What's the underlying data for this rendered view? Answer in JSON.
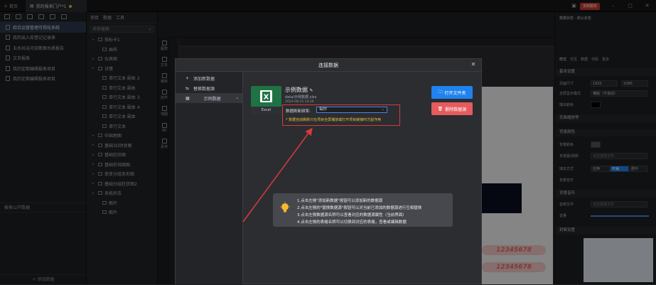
{
  "titlebar": {
    "home_tab": "首页",
    "project_tab": "我的报表门户*1",
    "brand_button": "定制服务"
  },
  "left_panel": {
    "projects": [
      "综合运营管理可视化系统",
      "我的出入库登记记录表",
      "五水共治河流断面水质报告",
      "文旦报表",
      "我的定期编辑报表项目",
      "我的定期编辑报表项目"
    ],
    "section_label": "报表公开数据",
    "add_data_label": "+ 添加数据"
  },
  "layer_panel": {
    "tabs": [
      "项目",
      "数据",
      "工具"
    ],
    "search_placeholder": "名称搜索",
    "items": [
      {
        "label": "指标卡1",
        "indent": 1
      },
      {
        "label": "画布",
        "indent": 2
      },
      {
        "label": "仪表图",
        "indent": 1
      },
      {
        "label": "详情",
        "indent": 1
      },
      {
        "label": "单行文本 副本 2",
        "indent": 2
      },
      {
        "label": "单行文本 副本",
        "indent": 2
      },
      {
        "label": "单行文本 副本 3",
        "indent": 2
      },
      {
        "label": "单行文本 副本 4",
        "indent": 2
      },
      {
        "label": "单行文本 副本",
        "indent": 2
      },
      {
        "label": "单行文本",
        "indent": 2
      },
      {
        "label": "中国地图",
        "indent": 1
      },
      {
        "label": "基础3D饼状图",
        "indent": 1
      },
      {
        "label": "基础柱状图",
        "indent": 1
      },
      {
        "label": "基础折线图图",
        "indent": 1
      },
      {
        "label": "渐变分组条形图",
        "indent": 1
      },
      {
        "label": "基础分组柱状图2",
        "indent": 1
      },
      {
        "label": "系统状态",
        "indent": 1
      },
      {
        "label": "图片",
        "indent": 2
      },
      {
        "label": "图片",
        "indent": 2
      }
    ]
  },
  "icon_strip": [
    "图表",
    "文本",
    "媒体",
    "控件",
    "地图",
    "3D",
    "素材"
  ],
  "canvas": {
    "dashboard_number_1": "12345678",
    "dashboard_number_2": "12345678"
  },
  "right_panel": {
    "title": "数据状态 · 默认状态",
    "tabs": [
      "样式",
      "交互",
      "数据",
      "代码",
      "更多"
    ],
    "basic_header": "基本设置",
    "page_size_label": "页面尺寸",
    "width": "1920",
    "height": "1080",
    "scale_label": "全屏显示模式",
    "scale_value": "横版（不滚动）",
    "fill_label": "填充颜色",
    "subheader_1": "页面缩放等",
    "bg_header": "背景颜色",
    "bg_color_label": "背景颜色",
    "bg_image_label": "背景图/视频",
    "bg_image_placeholder": "点击选择文件",
    "fill_mode_label": "填充方式",
    "fill_modes": [
      "拉伸",
      "平铺",
      "居中"
    ],
    "bg_music_label": "背景音乐",
    "music_header": "背景音乐",
    "music_label": "音频文件",
    "volume_label": "音量",
    "cover_header": "封面设置"
  },
  "dialog": {
    "title": "连接数据",
    "sidebar": [
      {
        "icon": "+",
        "label": "添加新数据"
      },
      {
        "icon": "⇆",
        "label": "替换数据源"
      },
      {
        "icon": "▦",
        "label": "示例数据",
        "selected": true
      }
    ],
    "file_title": "示例数据",
    "file_path": "data/示例数据.xlsx",
    "file_date": "2024-08-15 14:26",
    "excel_label": "Excel",
    "refresh_label": "数据刷新频率:",
    "refresh_value": "每秒",
    "warning": "* 数据自动刷新只在项目全屏播放或打开项目链接时才起作用",
    "open_file_button": "打开文件夹",
    "delete_button": "删除数据源",
    "tips": [
      "1.点击左侧\"添加新数据\"按钮可以添加新的数据源",
      "2.点击左侧的\"替换数据源\"按钮可以对当前已添加的数据源进行互相替换",
      "3.点击左侧数据源名称可以查看对应的数据源属性（当前界面）",
      "4.点击左侧的表格名称可以切换到对应的表格，查看或编辑数据"
    ]
  },
  "colors": {
    "accent_blue": "#1f82f0",
    "danger_red": "#e55b5e",
    "annotation_red": "#d93a3a",
    "warning_yellow": "#e8c33a",
    "excel_green": "#1f7244"
  }
}
